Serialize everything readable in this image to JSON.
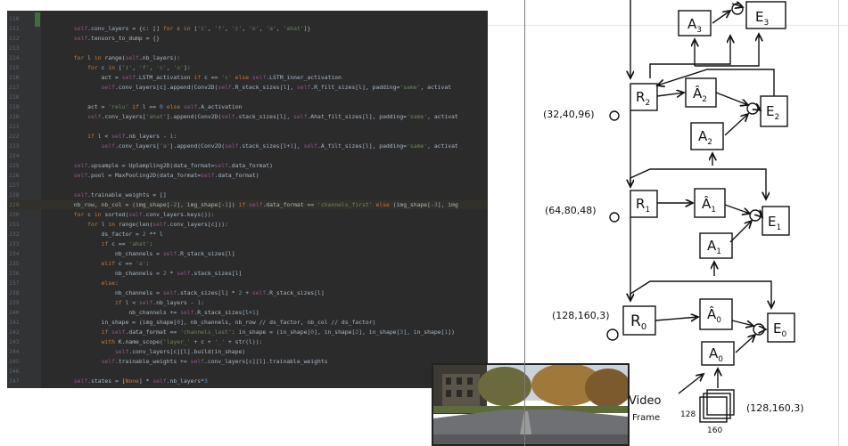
{
  "editor": {
    "lines": [
      {
        "n": "210",
        "t": ""
      },
      {
        "n": "211",
        "t": "        self.conv_layers = {c: [] for c in ['i', 'f', 'c', 'o', 'a', 'ahat']}"
      },
      {
        "n": "212",
        "t": "        self.tensors_to_dump = {}"
      },
      {
        "n": "213",
        "t": ""
      },
      {
        "n": "214",
        "t": "        for l in range(self.nb_layers):"
      },
      {
        "n": "215",
        "t": "            for c in ['i', 'f', 'c', 'o']:"
      },
      {
        "n": "216",
        "t": "                act = self.LSTM_activation if c == 'c' else self.LSTM_inner_activation"
      },
      {
        "n": "217",
        "t": "                self.conv_layers[c].append(Conv2D(self.R_stack_sizes[l], self.R_filt_sizes[l], padding='same', activat"
      },
      {
        "n": "218",
        "t": ""
      },
      {
        "n": "219",
        "t": "            act = 'relu' if l == 0 else self.A_activation"
      },
      {
        "n": "220",
        "t": "            self.conv_layers['ahat'].append(Conv2D(self.stack_sizes[l], self.Ahat_filt_sizes[l], padding='same', activat"
      },
      {
        "n": "221",
        "t": ""
      },
      {
        "n": "222",
        "t": "            if l < self.nb_layers - 1:"
      },
      {
        "n": "223",
        "t": "                self.conv_layers['a'].append(Conv2D(self.stack_sizes[l+1], self.A_filt_sizes[l], padding='same', activat"
      },
      {
        "n": "224",
        "t": ""
      },
      {
        "n": "225",
        "t": "        self.upsample = UpSampling2D(data_format=self.data_format)"
      },
      {
        "n": "226",
        "t": "        self.pool = MaxPooling2D(data_format=self.data_format)"
      },
      {
        "n": "227",
        "t": ""
      },
      {
        "n": "228",
        "t": "        self.trainable_weights = []"
      },
      {
        "n": "229",
        "t": "        nb_row, nb_col = (img_shape[-2], img_shape[-1]) if self.data_format == 'channels_first' else (img_shape[-3], img"
      },
      {
        "n": "230",
        "t": "        for c in sorted(self.conv_layers.keys()):"
      },
      {
        "n": "231",
        "t": "            for l in range(len(self.conv_layers[c])):"
      },
      {
        "n": "232",
        "t": "                ds_factor = 2 ** l"
      },
      {
        "n": "233",
        "t": "                if c == 'ahat':"
      },
      {
        "n": "234",
        "t": "                    nb_channels = self.R_stack_sizes[l]"
      },
      {
        "n": "235",
        "t": "                elif c == 'a':"
      },
      {
        "n": "236",
        "t": "                    nb_channels = 2 * self.stack_sizes[l]"
      },
      {
        "n": "237",
        "t": "                else:"
      },
      {
        "n": "238",
        "t": "                    nb_channels = self.stack_sizes[l] * 2 + self.R_stack_sizes[l]"
      },
      {
        "n": "239",
        "t": "                    if l < self.nb_layers - 1:"
      },
      {
        "n": "240",
        "t": "                        nb_channels += self.R_stack_sizes[l+1]"
      },
      {
        "n": "241",
        "t": "                in_shape = (img_shape[0], nb_channels, nb_row // ds_factor, nb_col // ds_factor)"
      },
      {
        "n": "242",
        "t": "                if self.data_format == 'channels_last': in_shape = (in_shape[0], in_shape[2], in_shape[3], in_shape[1])"
      },
      {
        "n": "243",
        "t": "                with K.name_scope('layer_' + c + '_' + str(l)):"
      },
      {
        "n": "244",
        "t": "                    self.conv_layers[c][l].build(in_shape)"
      },
      {
        "n": "245",
        "t": "                self.trainable_weights += self.conv_layers[c][l].trainable_weights"
      },
      {
        "n": "246",
        "t": ""
      },
      {
        "n": "247",
        "t": "        self.states = [None] * self.nb_layers*3"
      }
    ]
  },
  "diagram": {
    "nodes": {
      "A3": "A",
      "A3_sub": "3",
      "E3": "E",
      "E3_sub": "3",
      "R2": "R",
      "R2_sub": "2",
      "Ahat2": "Â",
      "Ahat2_sub": "2",
      "E2": "E",
      "E2_sub": "2",
      "A2": "A",
      "A2_sub": "2",
      "R1": "R",
      "R1_sub": "1",
      "Ahat1": "Â",
      "Ahat1_sub": "1",
      "E1": "E",
      "E1_sub": "1",
      "A1": "A",
      "A1_sub": "1",
      "R0": "R",
      "R0_sub": "0",
      "Ahat0": "Â",
      "Ahat0_sub": "0",
      "E0": "E",
      "E0_sub": "0",
      "A0": "A",
      "A0_sub": "0"
    },
    "shapes": {
      "r2": "(32,40,96)",
      "r1": "(64,80,48)",
      "r0": "(128,160,3)",
      "frame": "(128,160,3)"
    },
    "video_label_1": "Video",
    "video_label_2": "Frame",
    "frame_dim_h": "128",
    "frame_dim_w": "160"
  },
  "colors": {
    "editor_bg": "#2b2b2b",
    "keyword": "#cc7832",
    "self": "#94558d",
    "string": "#6a8759",
    "number": "#6897bb"
  }
}
